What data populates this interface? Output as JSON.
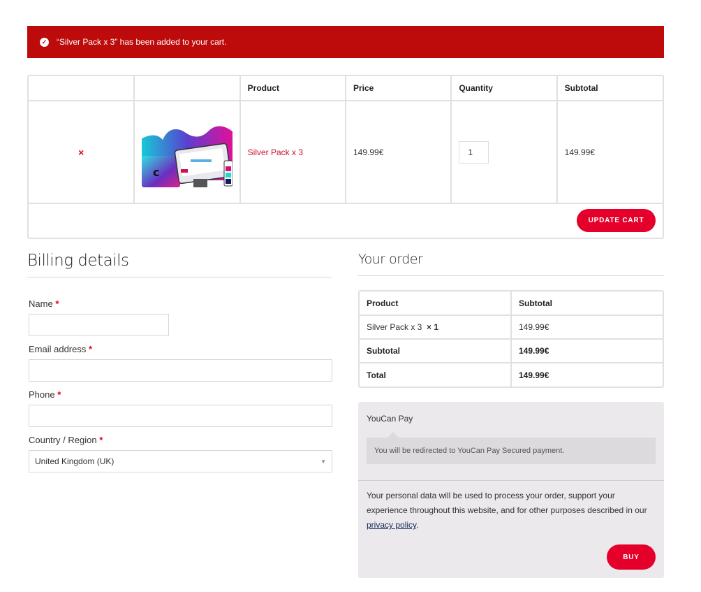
{
  "notice": {
    "icon": "check-circle-icon",
    "message": "“Silver Pack x 3” has been added to your cart."
  },
  "cart": {
    "headers": [
      "",
      "",
      "Product",
      "Price",
      "Quantity",
      "Subtotal"
    ],
    "items": [
      {
        "remove_icon": "×",
        "product_name": "Silver Pack x 3",
        "price": "149.99€",
        "quantity": "1",
        "subtotal": "149.99€"
      }
    ],
    "update_label": "UPDATE CART"
  },
  "billing": {
    "title": "Billing details",
    "required_mark": "*",
    "fields": {
      "name": {
        "label": "Name",
        "value": ""
      },
      "email": {
        "label": "Email address",
        "value": ""
      },
      "phone": {
        "label": "Phone",
        "value": ""
      },
      "country": {
        "label": "Country / Region",
        "value": "United Kingdom (UK)"
      }
    }
  },
  "order": {
    "title": "Your order",
    "headers": [
      "Product",
      "Subtotal"
    ],
    "line_item": {
      "name": "Silver Pack x 3",
      "qty": "× 1",
      "subtotal": "149.99€"
    },
    "subtotal_label": "Subtotal",
    "subtotal_value": "149.99€",
    "total_label": "Total",
    "total_value": "149.99€"
  },
  "payment": {
    "method": "YouCan Pay",
    "description": "You will be redirected to YouCan Pay Secured payment.",
    "privacy_before": "Your personal data will be used to process your order, support your experience throughout this website, and for other purposes described in our ",
    "privacy_link": "privacy policy",
    "privacy_after": ".",
    "buy_label": "BUY"
  },
  "colors": {
    "notice_bg": "#bd0a0a",
    "accent": "#e4002b",
    "link": "#c8102e"
  }
}
